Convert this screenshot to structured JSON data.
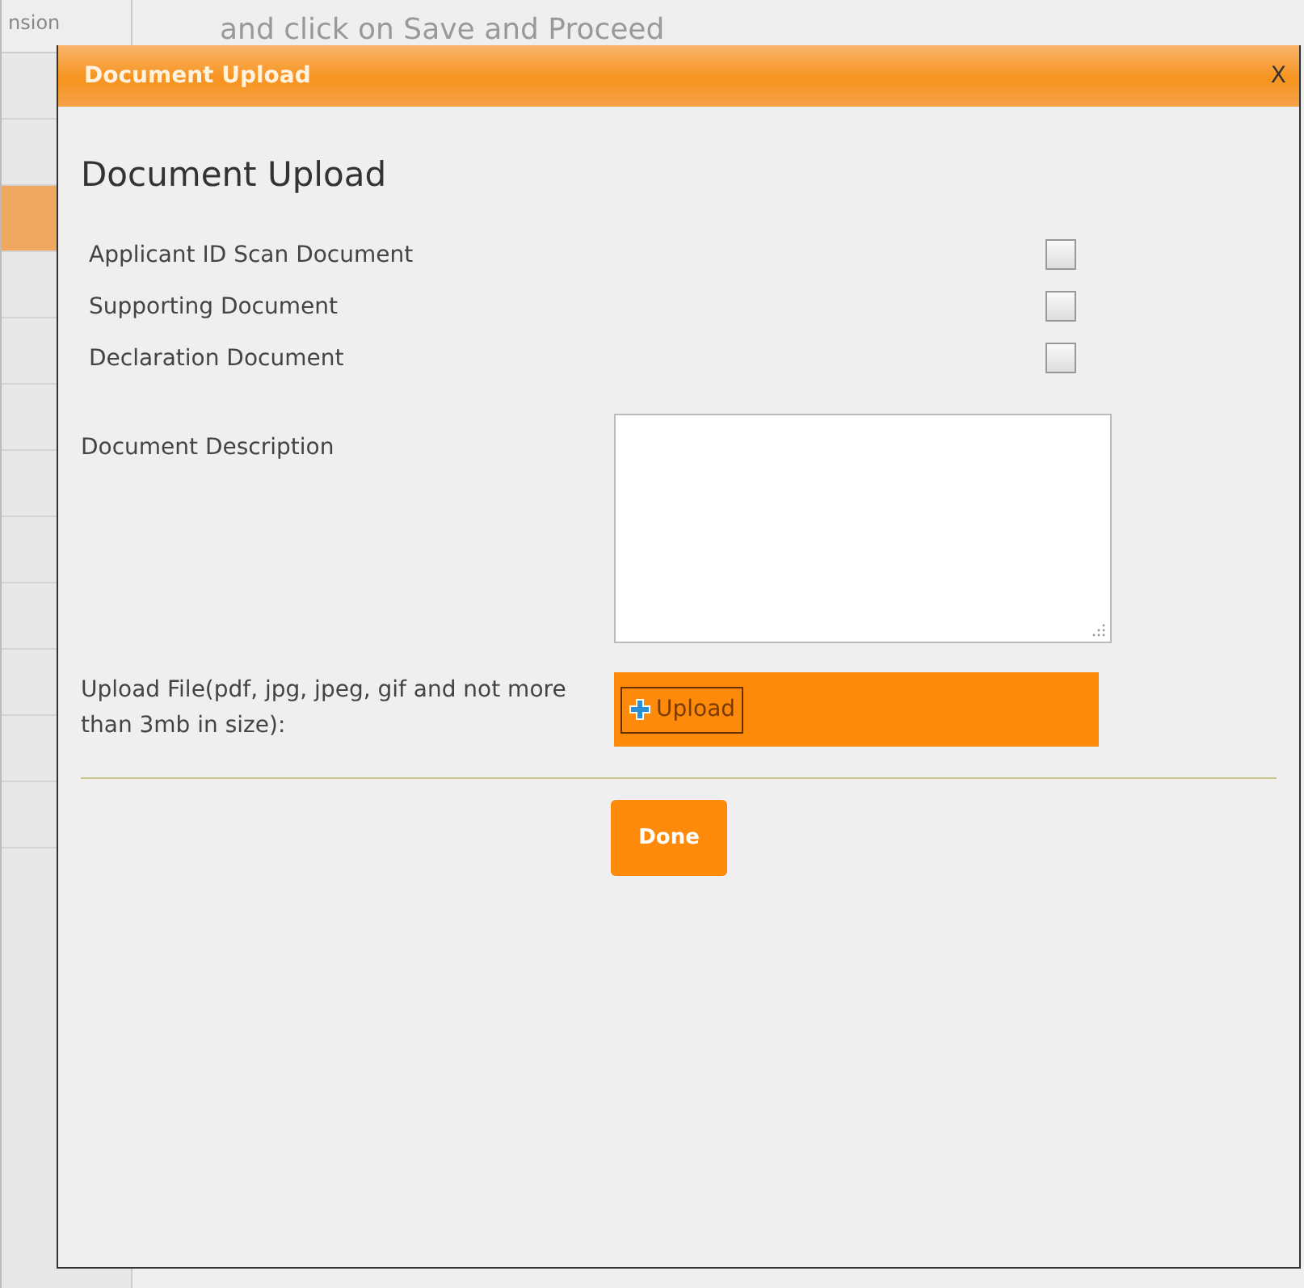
{
  "background": {
    "sidebar_cell": "nsion",
    "instruction": "and click on Save and Proceed"
  },
  "dialog": {
    "title": "Document Upload",
    "close": "X",
    "heading": "Document Upload",
    "documents": [
      {
        "label": "Applicant ID Scan Document",
        "checked": false
      },
      {
        "label": "Supporting Document",
        "checked": false
      },
      {
        "label": "Declaration Document",
        "checked": false
      }
    ],
    "description": {
      "label": "Document Description"
    },
    "upload": {
      "label": "Upload File(pdf, jpg, jpeg, gif and not more than 3mb in size):",
      "button": "Upload"
    },
    "done": "Done"
  }
}
